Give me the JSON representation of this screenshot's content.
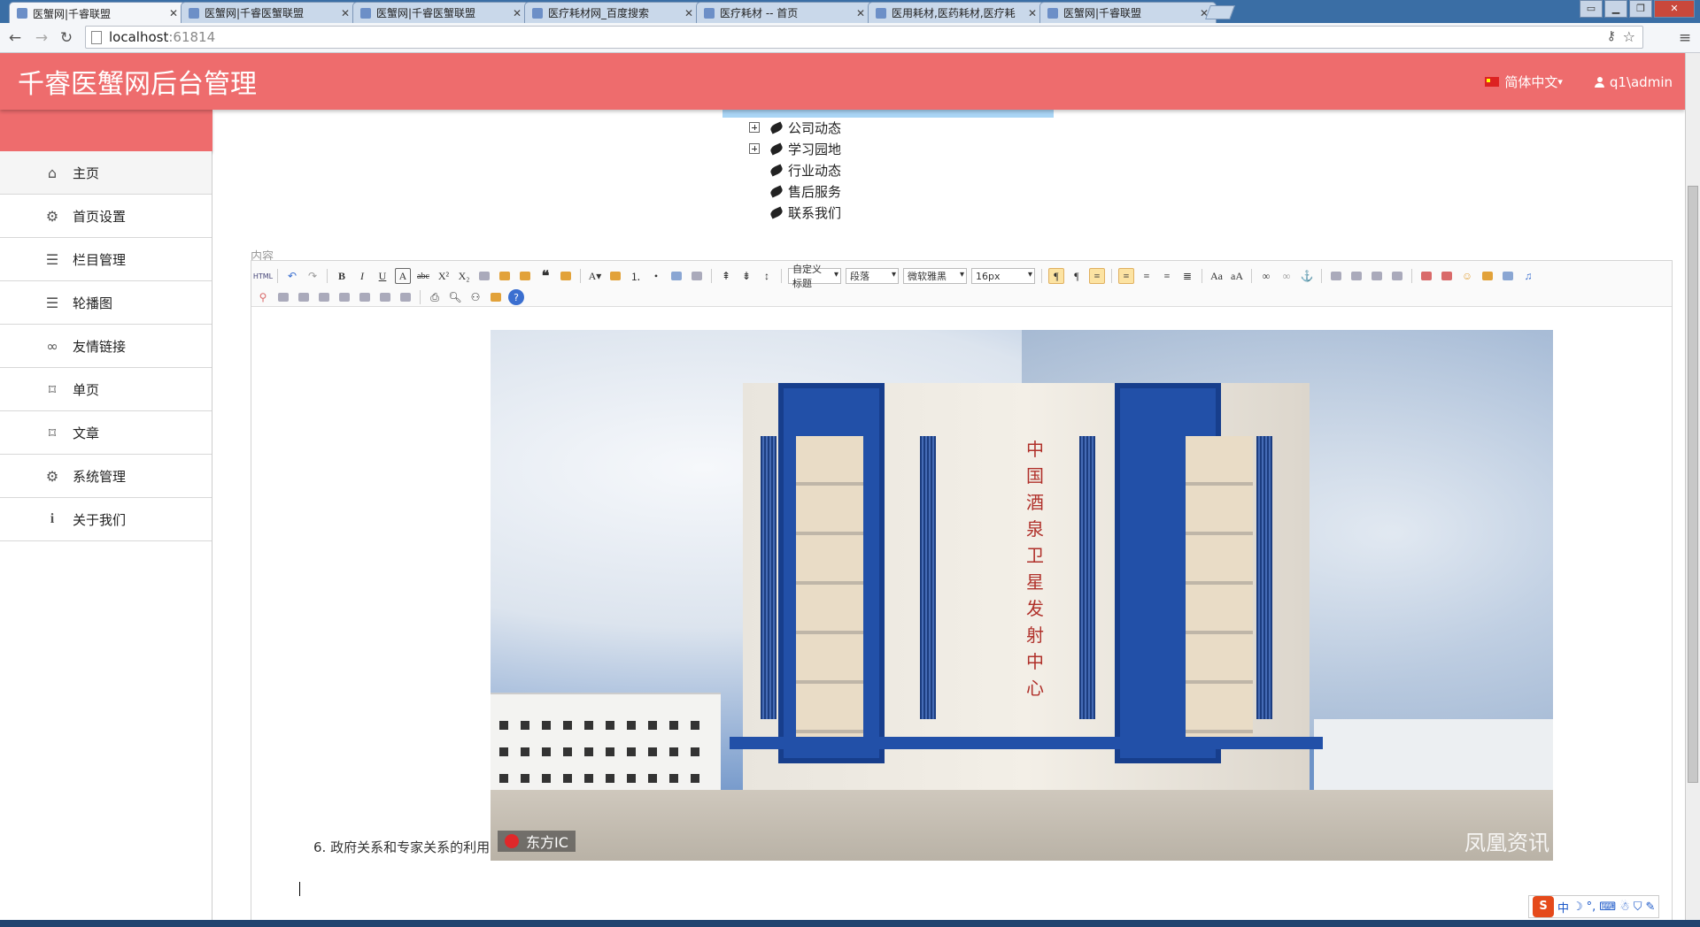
{
  "browser": {
    "tabs": [
      {
        "title": "医蟹网|千睿联盟",
        "active": true
      },
      {
        "title": "医蟹网|千睿医蟹联盟",
        "active": false
      },
      {
        "title": "医蟹网|千睿医蟹联盟",
        "active": false
      },
      {
        "title": "医疗耗材网_百度搜索",
        "active": false
      },
      {
        "title": "医疗耗材 -- 首页",
        "active": false
      },
      {
        "title": "医用耗材,医药耗材,医疗耗",
        "active": false
      },
      {
        "title": "医蟹网|千睿联盟",
        "active": false
      }
    ],
    "url_host": "localhost",
    "url_port": ":61814"
  },
  "header": {
    "brand": "千睿医蟹网后台管理",
    "language": "简体中文",
    "user": "q1\\admin"
  },
  "sidebar": {
    "items": [
      {
        "label": "主页",
        "icon": "home-icon"
      },
      {
        "label": "首页设置",
        "icon": "gear-icon"
      },
      {
        "label": "栏目管理",
        "icon": "list-icon"
      },
      {
        "label": "轮播图",
        "icon": "list-icon"
      },
      {
        "label": "友情链接",
        "icon": "link-icon"
      },
      {
        "label": "单页",
        "icon": "bookmark-icon"
      },
      {
        "label": "文章",
        "icon": "bookmark-icon"
      },
      {
        "label": "系统管理",
        "icon": "gears-icon"
      },
      {
        "label": "关于我们",
        "icon": "info-icon"
      }
    ]
  },
  "tree": {
    "items": [
      {
        "label": "公司动态",
        "expandable": true
      },
      {
        "label": "学习园地",
        "expandable": true
      },
      {
        "label": "行业动态",
        "expandable": false
      },
      {
        "label": "售后服务",
        "expandable": false
      },
      {
        "label": "联系我们",
        "expandable": false
      }
    ]
  },
  "form": {
    "content_label": "内容"
  },
  "editor": {
    "dropdowns": {
      "custom_heading": "自定义标题",
      "paragraph": "段落",
      "font_family": "微软雅黑",
      "font_size": "16px"
    },
    "body": {
      "caption": "6. 政府关系和专家关系的利用",
      "image_building_text": "中国酒泉卫星发射中心",
      "image_watermark_left": "东方IC",
      "image_watermark_right": "凤凰资讯"
    }
  },
  "ime": {
    "mode": "中"
  },
  "colors": {
    "header_bg": "#ee6c6d",
    "tree_selection": "#a9d5f5"
  }
}
